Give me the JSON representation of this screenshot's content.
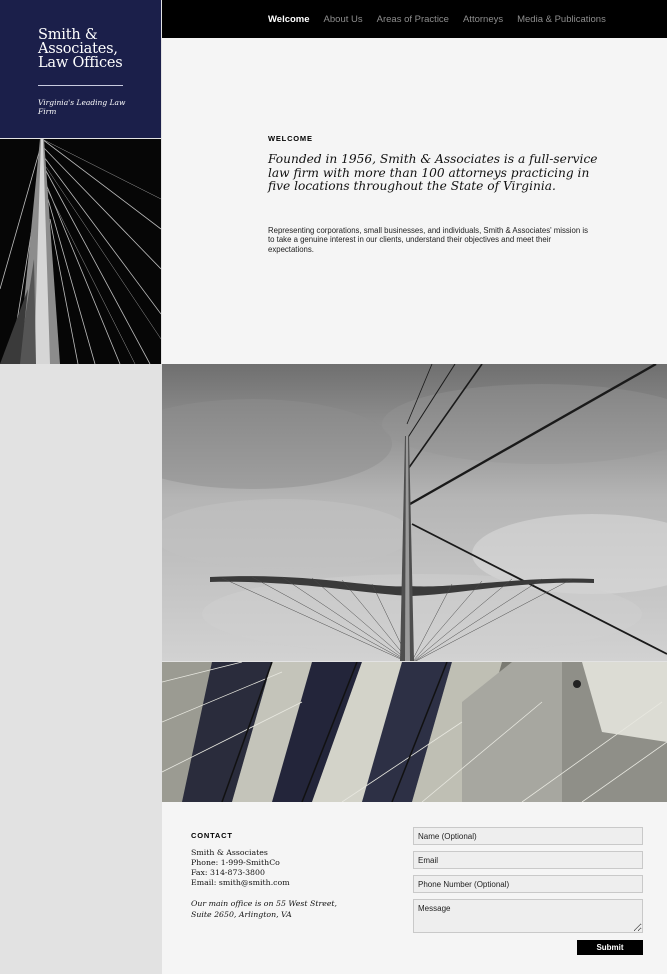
{
  "brand": {
    "name_line1": "Smith &",
    "name_line2": "Associates,",
    "name_line3": "Law Offices",
    "tagline": "Virginia's Leading Law Firm",
    "color": "#1b1f4a"
  },
  "nav": {
    "items": [
      {
        "label": "Welcome",
        "active": true
      },
      {
        "label": "About Us",
        "active": false
      },
      {
        "label": "Areas of Practice",
        "active": false
      },
      {
        "label": "Attorneys",
        "active": false
      },
      {
        "label": "Media & Publications",
        "active": false
      }
    ]
  },
  "intro": {
    "heading": "WELCOME",
    "lead": "Founded in 1956, Smith & Associates is a full-service law firm with more than 100 attorneys practicing in five locations throughout the State of Virginia.",
    "body": "Representing corporations, small businesses, and individuals, Smith & Associates' mission is to take a genuine interest in our clients, understand their objectives and meet their expectations."
  },
  "contact": {
    "heading": "CONTACT",
    "lines": [
      "Smith & Associates",
      "Phone: 1-999-SmithCo",
      "Fax: 314-873-3800",
      "Email: smith@smith.com"
    ],
    "note": "Our main office is on 55 West Street, Suite 2650, Arlington, VA"
  },
  "form": {
    "name_placeholder": "Name (Optional)",
    "email_placeholder": "Email",
    "phone_placeholder": "Phone Number (Optional)",
    "message_placeholder": "Message",
    "submit_label": "Submit"
  }
}
